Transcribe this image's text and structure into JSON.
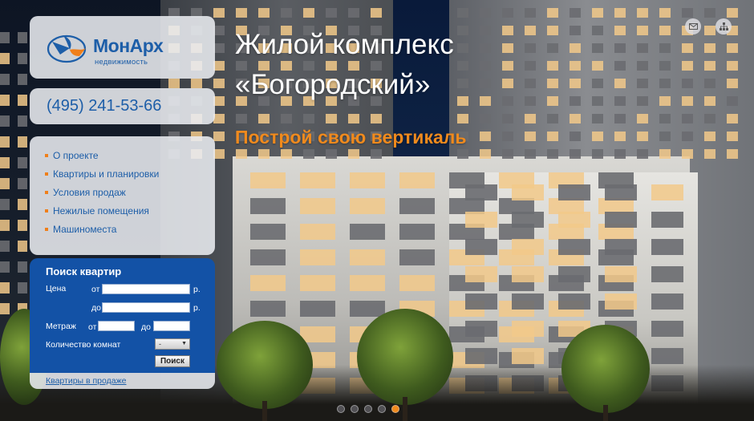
{
  "brand": {
    "name_part1": "Мон",
    "name_part2": "Арх",
    "tagline": "недвижимость"
  },
  "phone": "(495) 241-53-66",
  "menu": {
    "items": [
      {
        "label": "О проекте"
      },
      {
        "label": "Квартиры и планировки"
      },
      {
        "label": "Условия продаж"
      },
      {
        "label": "Нежилые помещения"
      },
      {
        "label": "Машиноместа"
      }
    ]
  },
  "headline": {
    "line1": "Жилой комплекс",
    "line2": "«Богородский»",
    "slogan": "Построй свою вертикаль"
  },
  "search": {
    "title": "Поиск квартир",
    "price_label": "Цена",
    "from_label": "от",
    "to_label": "до",
    "currency": "р.",
    "area_label": "Метраж",
    "rooms_label": "Количество комнат",
    "rooms_selected": "-",
    "submit_label": "Поиск"
  },
  "sale_link": "Квартиры в продаже",
  "icons": {
    "mail": "mail-icon",
    "sitemap": "sitemap-icon"
  },
  "slider": {
    "dot_count": 5,
    "active_index": 4
  },
  "colors": {
    "brand_blue": "#1d5ea8",
    "search_blue": "#1352a6",
    "accent_orange": "#f08a1d"
  }
}
